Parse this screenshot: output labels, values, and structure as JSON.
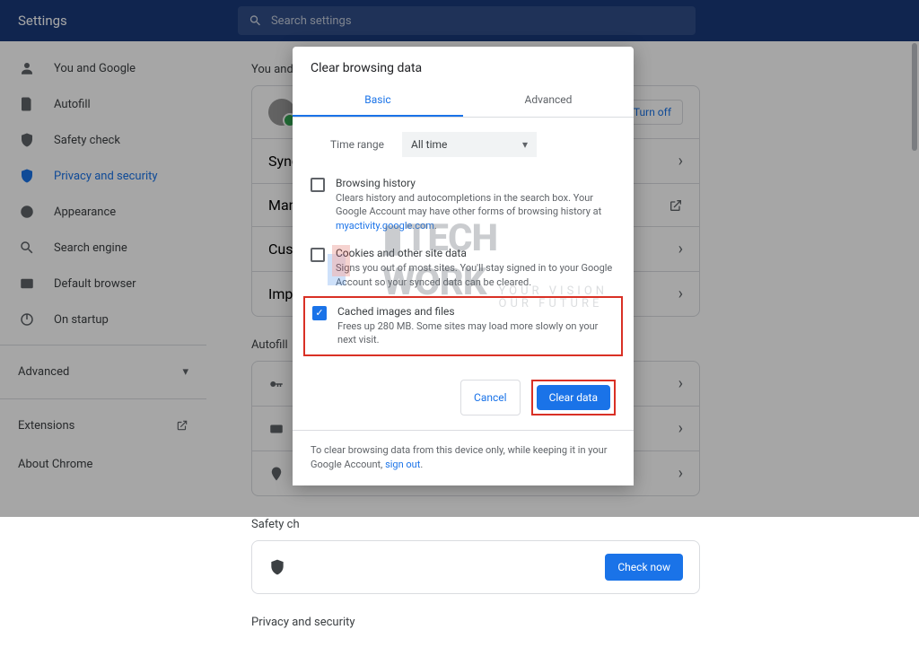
{
  "header": {
    "title": "Settings",
    "search_placeholder": "Search settings"
  },
  "sidebar": {
    "items": [
      {
        "label": "You and Google"
      },
      {
        "label": "Autofill"
      },
      {
        "label": "Safety check"
      },
      {
        "label": "Privacy and security"
      },
      {
        "label": "Appearance"
      },
      {
        "label": "Search engine"
      },
      {
        "label": "Default browser"
      },
      {
        "label": "On startup"
      }
    ],
    "advanced": "Advanced",
    "extensions": "Extensions",
    "about": "About Chrome"
  },
  "main": {
    "section1_title": "You and G",
    "turn_off": "Turn off",
    "row_sync": "Sync an",
    "row_manage": "Manag",
    "row_custom": "Custon",
    "row_import": "Import",
    "section2_title": "Autofill",
    "section3_title": "Safety ch",
    "check_now": "Check now",
    "section4_title": "Privacy and security"
  },
  "dialog": {
    "title": "Clear browsing data",
    "tabs": {
      "basic": "Basic",
      "advanced": "Advanced"
    },
    "time_label": "Time range",
    "time_value": "All time",
    "options": [
      {
        "title": "Browsing history",
        "desc_pre": "Clears history and autocompletions in the search box. Your Google Account may have other forms of browsing history at ",
        "desc_link": "myactivity.google.com",
        "desc_post": ".",
        "checked": false
      },
      {
        "title": "Cookies and other site data",
        "desc": "Signs you out of most sites. You'll stay signed in to your Google Account so your synced data can be cleared.",
        "checked": false
      },
      {
        "title": "Cached images and files",
        "desc": "Frees up 280 MB. Some sites may load more slowly on your next visit.",
        "checked": true
      }
    ],
    "cancel": "Cancel",
    "clear": "Clear data",
    "footer_pre": "To clear browsing data from this device only, while keeping it in your Google Account, ",
    "footer_link": "sign out",
    "footer_post": "."
  },
  "watermark": {
    "brand_line1": "TECH",
    "brand_line2": "WORK",
    "tag1": "YOUR VISION",
    "tag2": "OUR FUTURE"
  }
}
